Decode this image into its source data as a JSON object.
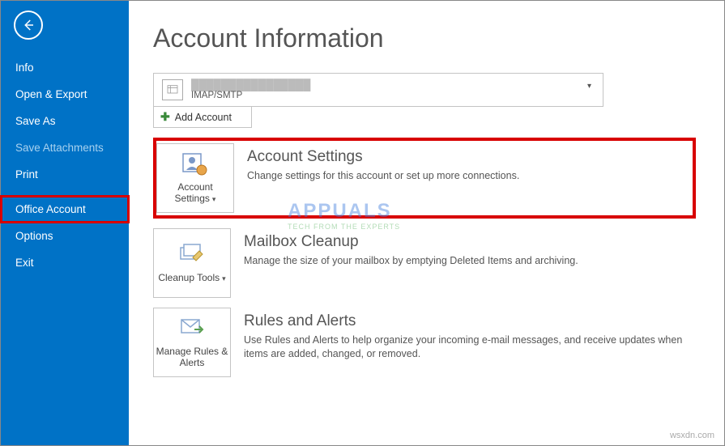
{
  "sidebar": {
    "items": [
      {
        "label": "Info",
        "disabled": false
      },
      {
        "label": "Open & Export",
        "disabled": false
      },
      {
        "label": "Save As",
        "disabled": false
      },
      {
        "label": "Save Attachments",
        "disabled": true
      },
      {
        "label": "Print",
        "disabled": false
      },
      {
        "label": "Office Account",
        "disabled": false
      },
      {
        "label": "Options",
        "disabled": false
      },
      {
        "label": "Exit",
        "disabled": false
      }
    ]
  },
  "page": {
    "title": "Account Information"
  },
  "account": {
    "email_masked": "████████████████",
    "type": "IMAP/SMTP",
    "add_label": "Add Account"
  },
  "sections": [
    {
      "button": "Account Settings",
      "title": "Account Settings",
      "desc": "Change settings for this account or set up more connections."
    },
    {
      "button": "Cleanup Tools",
      "title": "Mailbox Cleanup",
      "desc": "Manage the size of your mailbox by emptying Deleted Items and archiving."
    },
    {
      "button": "Manage Rules & Alerts",
      "title": "Rules and Alerts",
      "desc": "Use Rules and Alerts to help organize your incoming e-mail messages, and receive updates when items are added, changed, or removed."
    }
  ],
  "watermark": {
    "text": "APPUALS",
    "sub": "TECH FROM THE EXPERTS"
  },
  "footer": {
    "credit": "wsxdn.com"
  },
  "colors": {
    "brand": "#0072c6",
    "highlight": "#d80000"
  }
}
